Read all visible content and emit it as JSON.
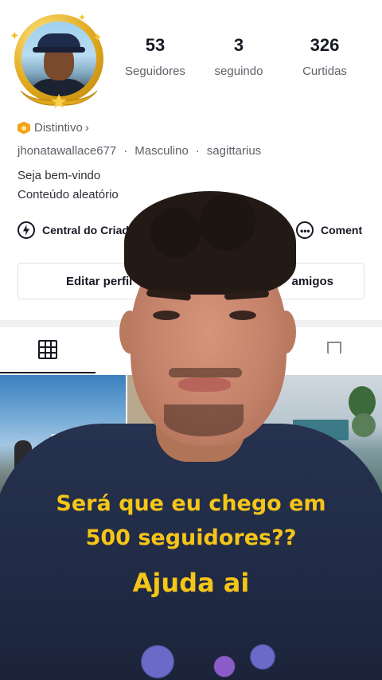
{
  "profile": {
    "stats": [
      {
        "value": "53",
        "label": "Seguidores"
      },
      {
        "value": "3",
        "label": "seguindo"
      },
      {
        "value": "326",
        "label": "Curtidas"
      }
    ],
    "badge_label": "Distintivo",
    "badge_chevron": "›",
    "username": "jhonatawallace677",
    "gender": "Masculino",
    "sign": "sagittarius",
    "meta_separator": "·",
    "bio_line1": "Seja bem-vindo",
    "bio_line2": "Conteúdo aleatório",
    "creator_center": "Central do Criador",
    "comments_partial": "Coment",
    "edit_button": "Editar perfil",
    "friends_button": "amigos"
  },
  "overlay": {
    "caption_line1": "Será que eu chego em",
    "caption_line2": "500 seguidores??",
    "caption_line3": "Ajuda ai",
    "caption_color": "#f5c518"
  },
  "icons": {
    "grid": "grid-icon",
    "saved": "bookmark-icon",
    "creator": "bolt-icon",
    "comments": "chat-dots-icon",
    "video": "video-icon"
  }
}
